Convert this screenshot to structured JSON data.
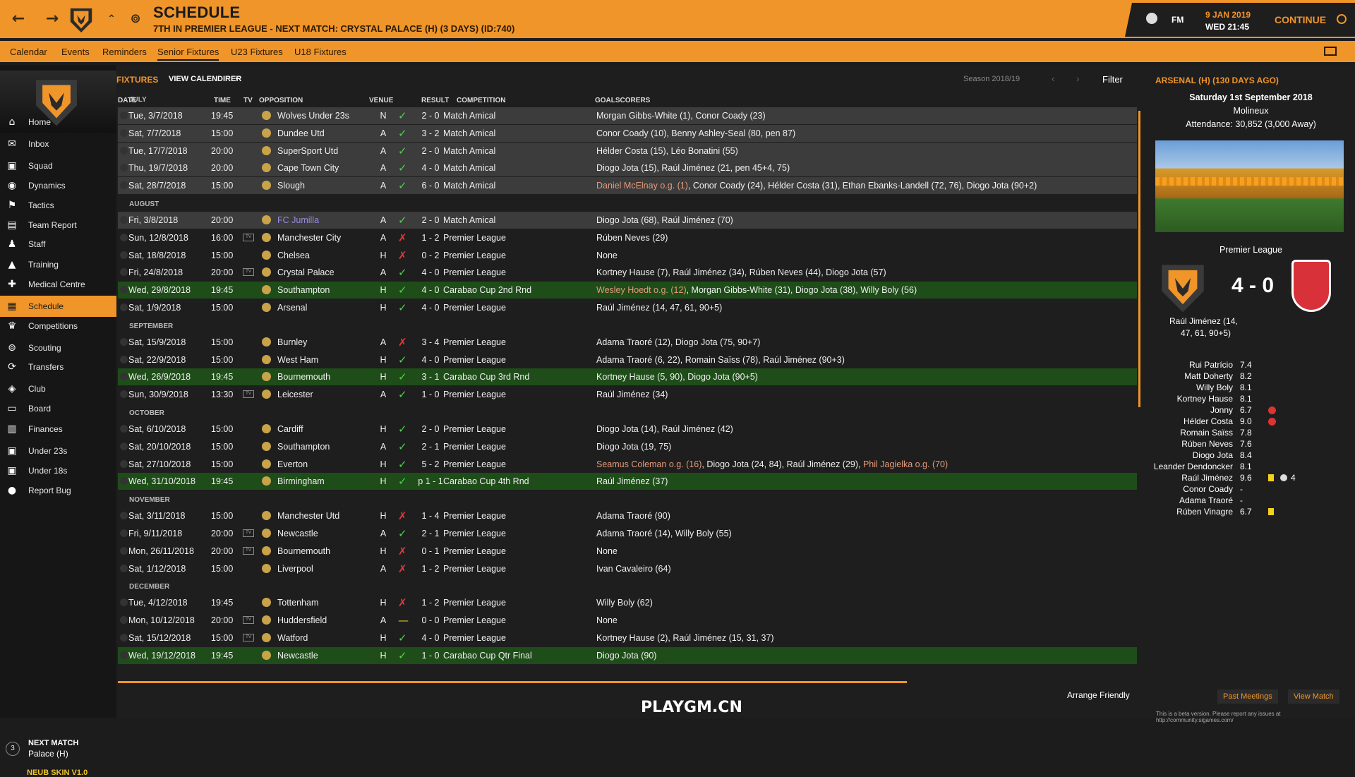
{
  "header": {
    "title": "SCHEDULE",
    "subtitle": "7TH IN PREMIER LEAGUE - NEXT MATCH: CRYSTAL PALACE (H) (3 DAYS) (ID:740)",
    "date": "9 JAN 2019",
    "time": "WED 21:45",
    "fm": "FM",
    "continue": "CONTINUE"
  },
  "tabs": [
    "Calendar",
    "Events",
    "Reminders",
    "Senior Fixtures",
    "U23 Fixtures",
    "U18 Fixtures"
  ],
  "sidebar": [
    "Home",
    "Inbox",
    "Squad",
    "Dynamics",
    "Tactics",
    "Team Report",
    "Staff",
    "Training",
    "Medical Centre",
    "Schedule",
    "Competitions",
    "Scouting",
    "Transfers",
    "Club",
    "Board",
    "Finances",
    "Under 23s",
    "Under 18s",
    "Report Bug"
  ],
  "next_match": {
    "label": "NEXT MATCH",
    "team": "Palace (H)",
    "days": "3",
    "skin": "NEUB SKIN V1.0"
  },
  "toolbar": {
    "fixtures": "FIXTURES",
    "view": "VIEW CALENDIRER",
    "season": "Season 2018/19",
    "filter": "Filter"
  },
  "columns": {
    "date": "DATE",
    "time": "TIME",
    "tv": "TV",
    "opp": "OPPOSITION",
    "venue": "VENUE",
    "result": "RESULT",
    "comp": "COMPETITION",
    "goals": "GOALSCORERS"
  },
  "months": [
    "JULY",
    "AUGUST",
    "SEPTEMBER",
    "OCTOBER",
    "NOVEMBER",
    "DECEMBER"
  ],
  "fixtures": [
    {
      "date": "Tue, 3/7/2018",
      "time": "19:45",
      "tv": false,
      "opp": "Wolves Under 23s",
      "venue": "N",
      "res": "W",
      "score": "2 - 0",
      "comp": "Match Amical",
      "goals": "Morgan Gibbs-White (1), Conor Coady (23)",
      "type": "friendly"
    },
    {
      "date": "Sat, 7/7/2018",
      "time": "15:00",
      "tv": false,
      "opp": "Dundee Utd",
      "venue": "A",
      "res": "W",
      "score": "3 - 2",
      "comp": "Match Amical",
      "goals": "Conor Coady (10), Benny Ashley-Seal (80, pen 87)",
      "type": "friendly"
    },
    {
      "date": "Tue, 17/7/2018",
      "time": "20:00",
      "tv": false,
      "opp": "SuperSport Utd",
      "venue": "A",
      "res": "W",
      "score": "2 - 0",
      "comp": "Match Amical",
      "goals": "Hélder Costa (15), Léo Bonatini (55)",
      "type": "friendly"
    },
    {
      "date": "Thu, 19/7/2018",
      "time": "20:00",
      "tv": false,
      "opp": "Cape Town City",
      "venue": "A",
      "res": "W",
      "score": "4 - 0",
      "comp": "Match Amical",
      "goals": "Diogo Jota (15), Raúl Jiménez (21, pen 45+4, 75)",
      "type": "friendly"
    },
    {
      "date": "Sat, 28/7/2018",
      "time": "15:00",
      "tv": false,
      "opp": "Slough",
      "venue": "A",
      "res": "W",
      "score": "6 - 0",
      "comp": "Match Amical",
      "og": "Daniel McElnay o.g. (1)",
      "goals": ", Conor Coady (24), Hélder Costa (31), Ethan Ebanks-Landell (72, 76), Diogo Jota (90+2)",
      "type": "friendly"
    },
    {
      "date": "Fri, 3/8/2018",
      "time": "20:00",
      "tv": false,
      "opp": "FC Jumilla",
      "venue": "A",
      "res": "W",
      "score": "2 - 0",
      "comp": "Match Amical",
      "goals": "Diogo Jota (68), Raúl Jiménez (70)",
      "type": "friendly",
      "link": true
    },
    {
      "date": "Sun, 12/8/2018",
      "time": "16:00",
      "tv": true,
      "opp": "Manchester City",
      "venue": "A",
      "res": "L",
      "score": "1 - 2",
      "comp": "Premier League",
      "goals": "Rúben Neves (29)",
      "type": "plain"
    },
    {
      "date": "Sat, 18/8/2018",
      "time": "15:00",
      "tv": false,
      "opp": "Chelsea",
      "venue": "H",
      "res": "L",
      "score": "0 - 2",
      "comp": "Premier League",
      "goals": "None",
      "type": "plain"
    },
    {
      "date": "Fri, 24/8/2018",
      "time": "20:00",
      "tv": true,
      "opp": "Crystal Palace",
      "venue": "A",
      "res": "W",
      "score": "4 - 0",
      "comp": "Premier League",
      "goals": "Kortney Hause (7), Raúl Jiménez (34), Rúben Neves (44), Diogo Jota (57)",
      "type": "plain"
    },
    {
      "date": "Wed, 29/8/2018",
      "time": "19:45",
      "tv": false,
      "opp": "Southampton",
      "venue": "H",
      "res": "W",
      "score": "4 - 0",
      "comp": "Carabao Cup 2nd Rnd",
      "og": "Wesley Hoedt o.g. (12)",
      "goals": ", Morgan Gibbs-White (31), Diogo Jota (38), Willy Boly (56)",
      "type": "cup"
    },
    {
      "date": "Sat, 1/9/2018",
      "time": "15:00",
      "tv": false,
      "opp": "Arsenal",
      "venue": "H",
      "res": "W",
      "score": "4 - 0",
      "comp": "Premier League",
      "goals": "Raúl Jiménez (14, 47, 61, 90+5)",
      "type": "plain"
    },
    {
      "date": "Sat, 15/9/2018",
      "time": "15:00",
      "tv": false,
      "opp": "Burnley",
      "venue": "A",
      "res": "L",
      "score": "3 - 4",
      "comp": "Premier League",
      "goals": "Adama Traoré (12), Diogo Jota (75, 90+7)",
      "type": "plain"
    },
    {
      "date": "Sat, 22/9/2018",
      "time": "15:00",
      "tv": false,
      "opp": "West Ham",
      "venue": "H",
      "res": "W",
      "score": "4 - 0",
      "comp": "Premier League",
      "goals": "Adama Traoré (6, 22), Romain Saïss (78), Raúl Jiménez (90+3)",
      "type": "plain"
    },
    {
      "date": "Wed, 26/9/2018",
      "time": "19:45",
      "tv": false,
      "opp": "Bournemouth",
      "venue": "H",
      "res": "W",
      "score": "3 - 1",
      "comp": "Carabao Cup 3rd Rnd",
      "goals": "Kortney Hause (5, 90), Diogo Jota (90+5)",
      "type": "cup"
    },
    {
      "date": "Sun, 30/9/2018",
      "time": "13:30",
      "tv": true,
      "opp": "Leicester",
      "venue": "A",
      "res": "W",
      "score": "1 - 0",
      "comp": "Premier League",
      "goals": "Raúl Jiménez (34)",
      "type": "plain"
    },
    {
      "date": "Sat, 6/10/2018",
      "time": "15:00",
      "tv": false,
      "opp": "Cardiff",
      "venue": "H",
      "res": "W",
      "score": "2 - 0",
      "comp": "Premier League",
      "goals": "Diogo Jota (14), Raúl Jiménez (42)",
      "type": "plain"
    },
    {
      "date": "Sat, 20/10/2018",
      "time": "15:00",
      "tv": false,
      "opp": "Southampton",
      "venue": "A",
      "res": "W",
      "score": "2 - 1",
      "comp": "Premier League",
      "goals": "Diogo Jota (19, 75)",
      "type": "plain"
    },
    {
      "date": "Sat, 27/10/2018",
      "time": "15:00",
      "tv": false,
      "opp": "Everton",
      "venue": "H",
      "res": "W",
      "score": "5 - 2",
      "comp": "Premier League",
      "og": "Seamus Coleman o.g. (16)",
      "goals": ", Diogo Jota (24, 84), Raúl Jiménez (29), ",
      "og2": "Phil Jagielka o.g. (70)",
      "type": "plain"
    },
    {
      "date": "Wed, 31/10/2018",
      "time": "19:45",
      "tv": false,
      "opp": "Birmingham",
      "venue": "H",
      "res": "W",
      "score": "p 1 - 1",
      "comp": "Carabao Cup 4th Rnd",
      "goals": "Raúl Jiménez (37)",
      "type": "cup"
    },
    {
      "date": "Sat, 3/11/2018",
      "time": "15:00",
      "tv": false,
      "opp": "Manchester Utd",
      "venue": "H",
      "res": "L",
      "score": "1 - 4",
      "comp": "Premier League",
      "goals": "Adama Traoré (90)",
      "type": "plain"
    },
    {
      "date": "Fri, 9/11/2018",
      "time": "20:00",
      "tv": true,
      "opp": "Newcastle",
      "venue": "A",
      "res": "W",
      "score": "2 - 1",
      "comp": "Premier League",
      "goals": "Adama Traoré (14), Willy Boly (55)",
      "type": "plain"
    },
    {
      "date": "Mon, 26/11/2018",
      "time": "20:00",
      "tv": true,
      "opp": "Bournemouth",
      "venue": "H",
      "res": "L",
      "score": "0 - 1",
      "comp": "Premier League",
      "goals": "None",
      "type": "plain"
    },
    {
      "date": "Sat, 1/12/2018",
      "time": "15:00",
      "tv": false,
      "opp": "Liverpool",
      "venue": "A",
      "res": "L",
      "score": "1 - 2",
      "comp": "Premier League",
      "goals": "Ivan Cavaleiro (64)",
      "type": "plain"
    },
    {
      "date": "Tue, 4/12/2018",
      "time": "19:45",
      "tv": false,
      "opp": "Tottenham",
      "venue": "H",
      "res": "L",
      "score": "1 - 2",
      "comp": "Premier League",
      "goals": "Willy Boly (62)",
      "type": "plain"
    },
    {
      "date": "Mon, 10/12/2018",
      "time": "20:00",
      "tv": true,
      "opp": "Huddersfield",
      "venue": "A",
      "res": "D",
      "score": "0 - 0",
      "comp": "Premier League",
      "goals": "None",
      "type": "plain"
    },
    {
      "date": "Sat, 15/12/2018",
      "time": "15:00",
      "tv": true,
      "opp": "Watford",
      "venue": "H",
      "res": "W",
      "score": "4 - 0",
      "comp": "Premier League",
      "goals": "Kortney Hause (2), Raúl Jiménez (15, 31, 37)",
      "type": "plain"
    },
    {
      "date": "Wed, 19/12/2018",
      "time": "19:45",
      "tv": false,
      "opp": "Newcastle",
      "venue": "H",
      "res": "W",
      "score": "1 - 0",
      "comp": "Carabao Cup Qtr Final",
      "goals": "Diogo Jota (90)",
      "type": "cup"
    }
  ],
  "arrange": "Arrange Friendly",
  "panel": {
    "title": "ARSENAL (H) (130 DAYS AGO)",
    "date": "Saturday 1st September 2018",
    "venue": "Molineux",
    "attendance": "Attendance: 30,852 (3,000 Away)",
    "competition": "Premier League",
    "score": "4 - 0",
    "scorer": "Raúl Jiménez (14,",
    "scorer2": "47, 61, 90+5)",
    "players": [
      [
        "Rui Patrício",
        "7.4",
        ""
      ],
      [
        "Matt Doherty",
        "8.2",
        ""
      ],
      [
        "Willy Boly",
        "8.1",
        ""
      ],
      [
        "Kortney Hause",
        "8.1",
        ""
      ],
      [
        "Jonny",
        "6.7",
        "inj"
      ],
      [
        "Hélder Costa",
        "9.0",
        "inj"
      ],
      [
        "Romain Saïss",
        "7.8",
        ""
      ],
      [
        "Rúben Neves",
        "7.6",
        ""
      ],
      [
        "Diogo Jota",
        "8.4",
        ""
      ],
      [
        "Leander Dendoncker",
        "8.1",
        ""
      ],
      [
        "Raúl Jiménez",
        "9.6",
        "yel4"
      ],
      [
        "Conor Coady",
        "-",
        ""
      ],
      [
        "Adama Traoré",
        "-",
        ""
      ],
      [
        "Rúben Vinagre",
        "6.7",
        "yel"
      ]
    ],
    "goals_count": "4",
    "past": "Past Meetings",
    "view": "View Match"
  },
  "watermark": "PLAYGM.CN",
  "footer": "This is a beta version. Please report any issues at http://community.sigames.com/"
}
